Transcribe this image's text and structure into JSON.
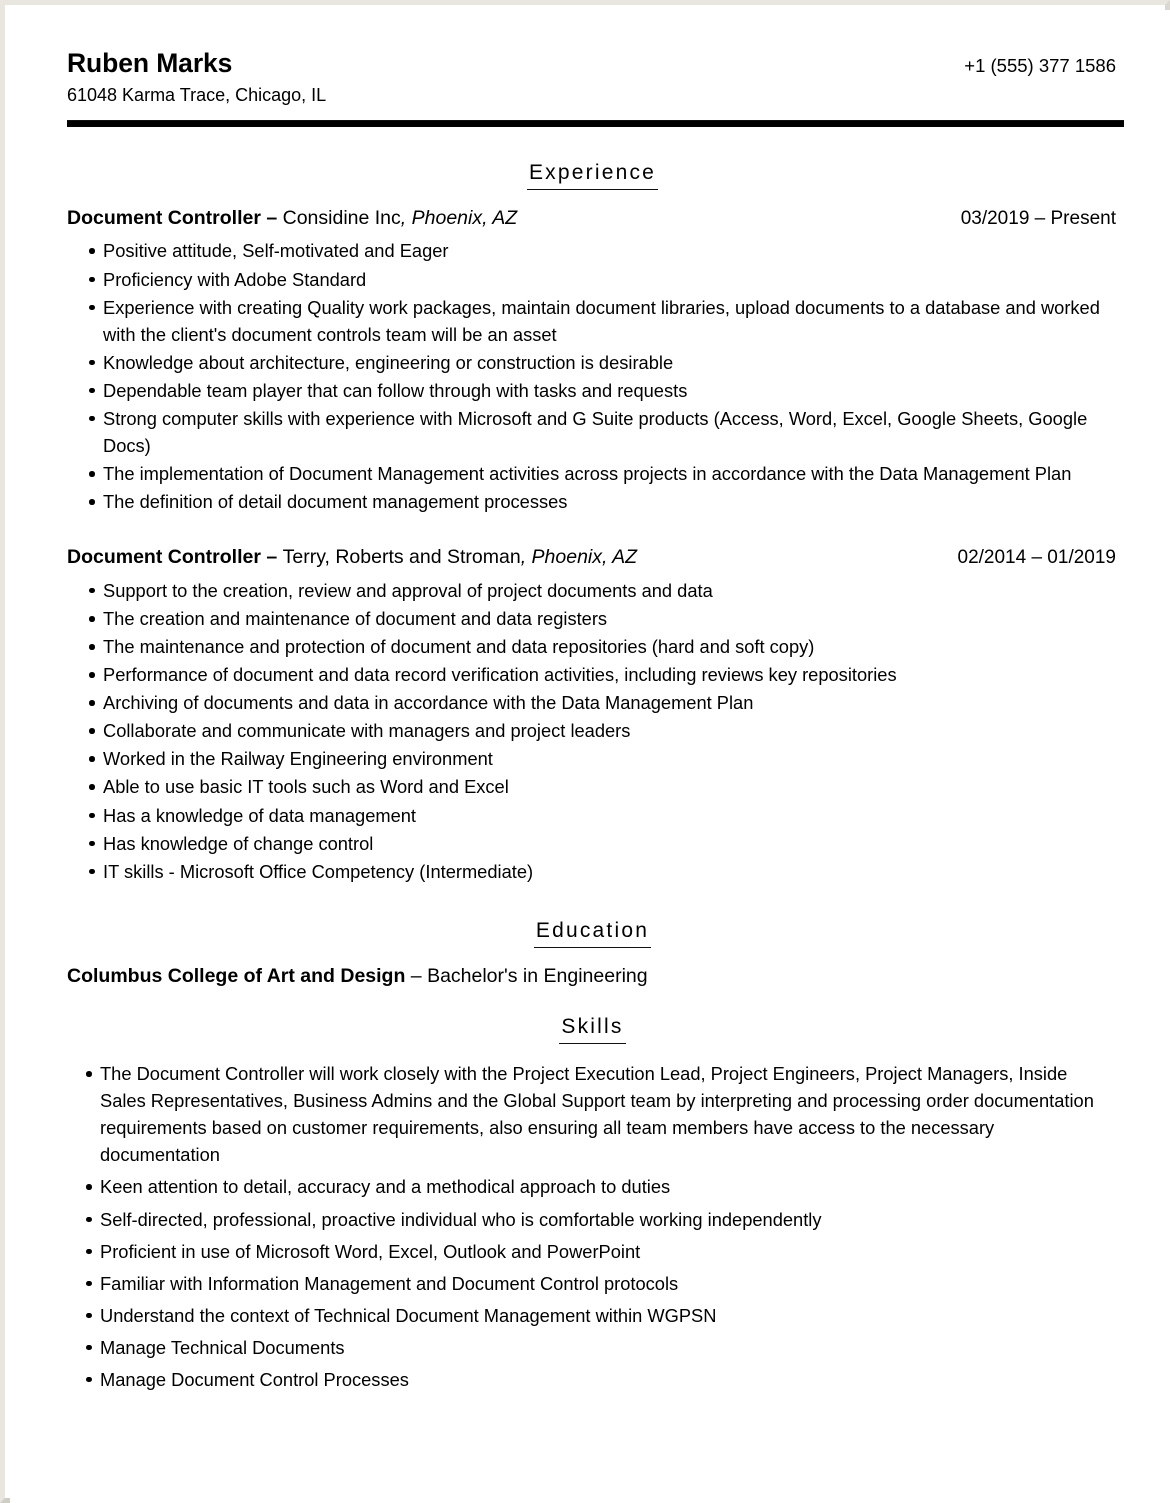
{
  "document": {
    "type": "resume",
    "header": {
      "full_name": "Ruben Marks",
      "phone": "+1 (555) 377 1586",
      "address": "61048 Karma Trace, Chicago, IL"
    },
    "sections": {
      "experience": {
        "heading": "Experience",
        "entries": [
          {
            "role": "Document Controller",
            "separator": " – ",
            "organization": "Considine Inc",
            "location": ", Phoenix, AZ",
            "dates": "03/2019 – Present",
            "bullets": [
              "Positive attitude, Self-motivated and Eager",
              "Proficiency with Adobe Standard",
              "Experience with creating Quality work packages, maintain document libraries, upload documents to a database and worked with the client's document controls team will be an asset",
              "Knowledge about architecture, engineering or construction is desirable",
              "Dependable team player that can follow through with tasks and requests",
              "Strong computer skills with experience with Microsoft and G Suite products (Access, Word, Excel, Google Sheets, Google Docs)",
              "The implementation of Document Management activities across projects in accordance with the Data Management Plan",
              "The definition of detail document management processes"
            ]
          },
          {
            "role": "Document Controller",
            "separator": " – ",
            "organization": "Terry, Roberts and Stroman",
            "location": ", Phoenix, AZ",
            "dates": "02/2014 – 01/2019",
            "bullets": [
              "Support to the creation, review and approval of project documents and data",
              "The creation and maintenance of document and data registers",
              "The maintenance and protection of document and data repositories (hard and soft copy)",
              "Performance of document and data record verification activities, including reviews key repositories",
              "Archiving of documents and data in accordance with the Data Management Plan",
              "Collaborate and communicate with managers and project leaders",
              "Worked in the Railway Engineering environment",
              "Able to use basic IT tools such as Word and Excel",
              "Has a knowledge of data management",
              "Has knowledge of change control",
              "IT skills - Microsoft Office Competency (Intermediate)"
            ]
          }
        ]
      },
      "education": {
        "heading": "Education",
        "entries": [
          {
            "school": "Columbus College of Art and Design",
            "separator": " – ",
            "degree": "Bachelor's in Engineering"
          }
        ]
      },
      "skills": {
        "heading": "Skills",
        "bullets": [
          "The Document Controller will work closely with the Project Execution Lead, Project Engineers, Project Managers, Inside Sales Representatives, Business Admins and the Global Support team by interpreting and processing order documentation requirements based on customer requirements, also ensuring all team members have access to the necessary documentation",
          "Keen attention to detail, accuracy and a methodical approach to duties",
          "Self-directed, professional, proactive individual who is comfortable working independently",
          "Proficient in use of Microsoft Word, Excel, Outlook and PowerPoint",
          "Familiar with Information Management and Document Control protocols",
          "Understand the context of Technical Document Management within WGPSN",
          "Manage Technical Documents",
          "Manage Document Control Processes"
        ]
      }
    }
  },
  "colors": {
    "text": "#000000",
    "page_background": "#ffffff",
    "page_border": "#e8e6df",
    "rule": "#000000"
  }
}
